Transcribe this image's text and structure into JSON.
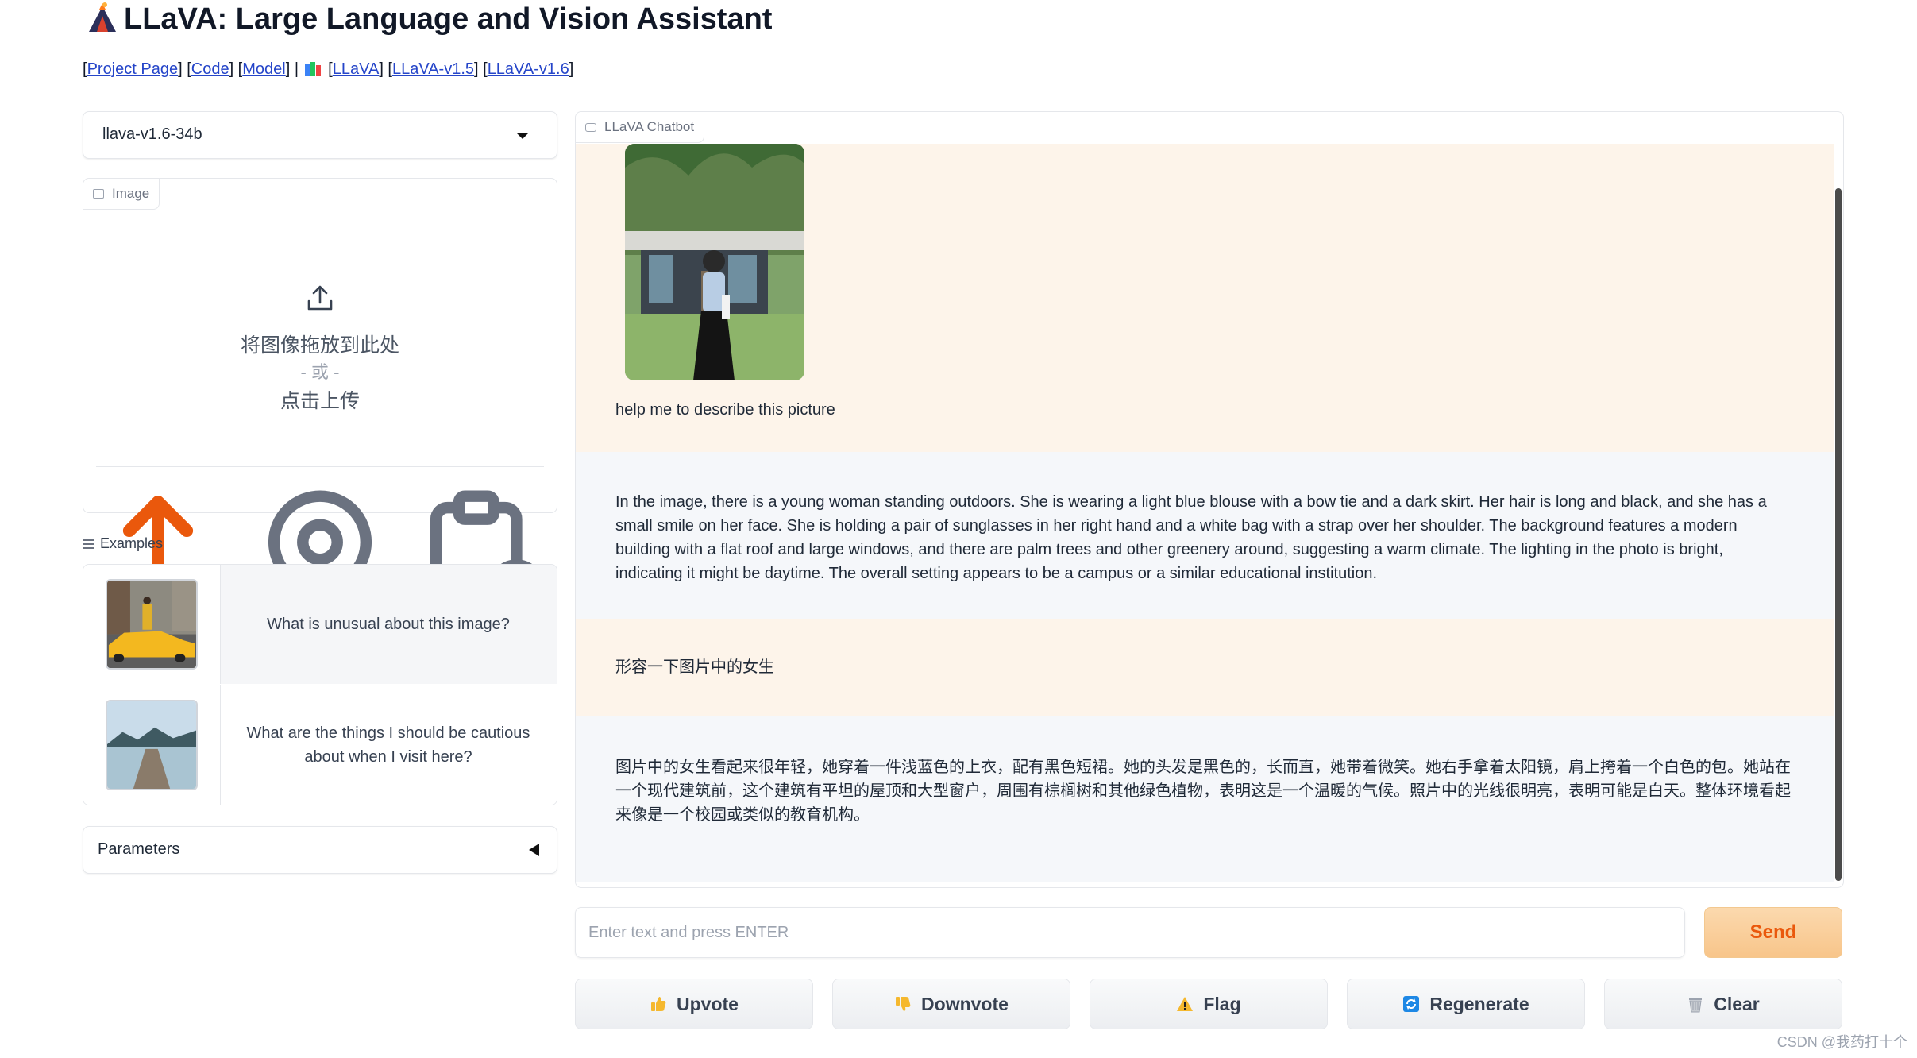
{
  "header": {
    "title": "LLaVA: Large Language and Vision Assistant",
    "links": {
      "project_page": "Project Page",
      "code": "Code",
      "model": "Model",
      "separator": "|",
      "llava": "LLaVA",
      "llava_v15": "LLaVA-v1.5",
      "llava_v16": "LLaVA-v1.6"
    }
  },
  "model_select": {
    "value": "llava-v1.6-34b"
  },
  "image_panel": {
    "label": "Image",
    "drop_text": "将图像拖放到此处",
    "or_text": "- 或 -",
    "click_text": "点击上传"
  },
  "examples": {
    "label": "Examples",
    "items": [
      {
        "text": "What is unusual about this image?"
      },
      {
        "text": "What are the things I should be cautious about when I visit here?"
      }
    ]
  },
  "parameters": {
    "label": "Parameters"
  },
  "chat": {
    "label": "LLaVA Chatbot",
    "messages": [
      {
        "role": "user",
        "text": "help me to describe this picture"
      },
      {
        "role": "bot",
        "text": "In the image, there is a young woman standing outdoors. She is wearing a light blue blouse with a bow tie and a dark skirt. Her hair is long and black, and she has a small smile on her face. She is holding a pair of sunglasses in her right hand and a white bag with a strap over her shoulder. The background features a modern building with a flat roof and large windows, and there are palm trees and other greenery around, suggesting a warm climate. The lighting in the photo is bright, indicating it might be daytime. The overall setting appears to be a campus or a similar educational institution."
      },
      {
        "role": "user",
        "text": "形容一下图片中的女生"
      },
      {
        "role": "bot",
        "text": "图片中的女生看起来很年轻，她穿着一件浅蓝色的上衣，配有黑色短裙。她的头发是黑色的，长而直，她带着微笑。她右手拿着太阳镜，肩上挎着一个白色的包。她站在一个现代建筑前，这个建筑有平坦的屋顶和大型窗户，周围有棕榈树和其他绿色植物，表明这是一个温暖的气候。照片中的光线很明亮，表明可能是白天。整体环境看起来像是一个校园或类似的教育机构。"
      }
    ]
  },
  "input": {
    "placeholder": "Enter text and press ENTER",
    "value": ""
  },
  "buttons": {
    "send": "Send",
    "upvote": "Upvote",
    "downvote": "Downvote",
    "flag": "Flag",
    "regenerate": "Regenerate",
    "clear": "Clear"
  },
  "watermark": "CSDN @我药打十个",
  "colors": {
    "accent": "#ea580c",
    "link": "#2545c9",
    "user_bg": "#fdf4ea",
    "bot_bg": "#f5f7fa"
  }
}
